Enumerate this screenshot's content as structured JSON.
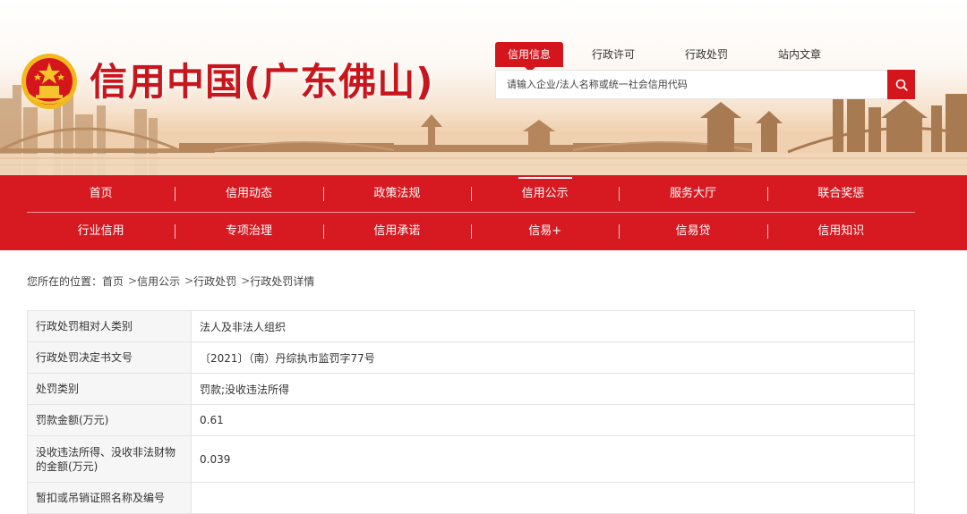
{
  "header": {
    "site_title": "信用中国(广东佛山)",
    "logo_icon": "national-emblem-icon",
    "search": {
      "tabs": [
        {
          "label": "信用信息",
          "active": true
        },
        {
          "label": "行政许可",
          "active": false
        },
        {
          "label": "行政处罚",
          "active": false
        },
        {
          "label": "站内文章",
          "active": false
        }
      ],
      "placeholder": "请输入企业/法人名称或统一社会信用代码",
      "button_icon": "search-icon"
    }
  },
  "nav": {
    "row1": [
      "首页",
      "信用动态",
      "政策法规",
      "信用公示",
      "服务大厅",
      "联合奖惩"
    ],
    "row2": [
      "行业信用",
      "专项治理",
      "信用承诺",
      "信易+",
      "信易贷",
      "信用知识"
    ],
    "active": "信用公示"
  },
  "breadcrumb": {
    "prefix": "您所在的位置：",
    "items": [
      "首页",
      "信用公示",
      "行政处罚",
      "行政处罚详情"
    ],
    "separator": ">"
  },
  "detail": {
    "rows": [
      {
        "label": "行政处罚相对人类别",
        "value": "法人及非法人组织"
      },
      {
        "label": "行政处罚决定书文号",
        "value": "〔2021〕（南）丹综执市监罚字77号"
      },
      {
        "label": "处罚类别",
        "value": "罚款;没收违法所得"
      },
      {
        "label": "罚款金额(万元)",
        "value": "0.61"
      },
      {
        "label": "没收违法所得、没收非法财物的金额(万元)",
        "value": "0.039"
      },
      {
        "label": "暂扣或吊销证照名称及编号",
        "value": ""
      }
    ]
  },
  "colors": {
    "brand_red": "#d71a21",
    "title_red": "#c8161d",
    "label_bg": "#f6f6f6",
    "border": "#e4e4e4"
  }
}
